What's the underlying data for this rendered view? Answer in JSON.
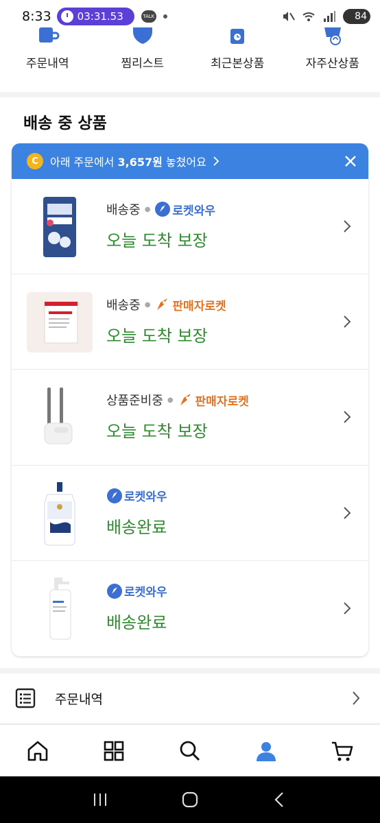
{
  "status_bar": {
    "time": "8:33",
    "timer": "03:31.53",
    "talk_badge": "TALK",
    "battery": "84"
  },
  "quick_menu": [
    {
      "label": "주문내역",
      "icon": "receipt-cup-icon"
    },
    {
      "label": "찜리스트",
      "icon": "heart-icon"
    },
    {
      "label": "최근본상품",
      "icon": "clock-bag-icon"
    },
    {
      "label": "자주산상품",
      "icon": "repeat-cart-icon"
    }
  ],
  "section": {
    "title": "배송 중 상품",
    "banner": {
      "coin": "C",
      "prefix": "아래 주문에서 ",
      "amount": "3,657원",
      "suffix": " 놓쳤어요"
    },
    "items": [
      {
        "status": "배송중",
        "badge": "로켓와우",
        "badge_type": "wow",
        "main": "오늘 도착 보장",
        "image": "laundry-detergent"
      },
      {
        "status": "배송중",
        "badge": "판매자로켓",
        "badge_type": "seller",
        "main": "오늘 도착 보장",
        "image": "supplement-box"
      },
      {
        "status": "상품준비중",
        "badge": "판매자로켓",
        "badge_type": "seller",
        "main": "오늘 도착 보장",
        "image": "toilet-brush"
      },
      {
        "status": "",
        "badge": "로켓와우",
        "badge_type": "wow",
        "main": "배송완료",
        "image": "dove-body-wash"
      },
      {
        "status": "",
        "badge": "로켓와우",
        "badge_type": "wow",
        "main": "배송완료",
        "image": "lotion-pump-bottle"
      }
    ]
  },
  "order_link": {
    "label": "주문내역"
  },
  "bottom_nav": [
    "home-icon",
    "category-grid-icon",
    "search-icon",
    "my-account-icon",
    "cart-icon"
  ],
  "colors": {
    "accent_blue": "#3c82e0",
    "green_text": "#2e8b2e",
    "wow_blue": "#3b6fd1",
    "seller_orange": "#e4721f",
    "timer_purple": "#5b3fd6"
  }
}
